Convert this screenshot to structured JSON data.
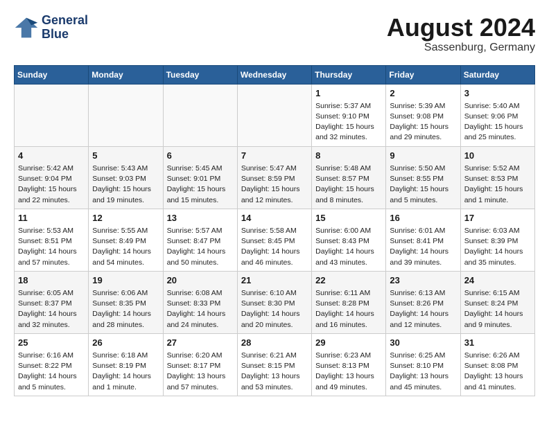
{
  "header": {
    "logo_line1": "General",
    "logo_line2": "Blue",
    "month_year": "August 2024",
    "location": "Sassenburg, Germany"
  },
  "weekdays": [
    "Sunday",
    "Monday",
    "Tuesday",
    "Wednesday",
    "Thursday",
    "Friday",
    "Saturday"
  ],
  "weeks": [
    [
      {
        "day": "",
        "info": ""
      },
      {
        "day": "",
        "info": ""
      },
      {
        "day": "",
        "info": ""
      },
      {
        "day": "",
        "info": ""
      },
      {
        "day": "1",
        "info": "Sunrise: 5:37 AM\nSunset: 9:10 PM\nDaylight: 15 hours\nand 32 minutes."
      },
      {
        "day": "2",
        "info": "Sunrise: 5:39 AM\nSunset: 9:08 PM\nDaylight: 15 hours\nand 29 minutes."
      },
      {
        "day": "3",
        "info": "Sunrise: 5:40 AM\nSunset: 9:06 PM\nDaylight: 15 hours\nand 25 minutes."
      }
    ],
    [
      {
        "day": "4",
        "info": "Sunrise: 5:42 AM\nSunset: 9:04 PM\nDaylight: 15 hours\nand 22 minutes."
      },
      {
        "day": "5",
        "info": "Sunrise: 5:43 AM\nSunset: 9:03 PM\nDaylight: 15 hours\nand 19 minutes."
      },
      {
        "day": "6",
        "info": "Sunrise: 5:45 AM\nSunset: 9:01 PM\nDaylight: 15 hours\nand 15 minutes."
      },
      {
        "day": "7",
        "info": "Sunrise: 5:47 AM\nSunset: 8:59 PM\nDaylight: 15 hours\nand 12 minutes."
      },
      {
        "day": "8",
        "info": "Sunrise: 5:48 AM\nSunset: 8:57 PM\nDaylight: 15 hours\nand 8 minutes."
      },
      {
        "day": "9",
        "info": "Sunrise: 5:50 AM\nSunset: 8:55 PM\nDaylight: 15 hours\nand 5 minutes."
      },
      {
        "day": "10",
        "info": "Sunrise: 5:52 AM\nSunset: 8:53 PM\nDaylight: 15 hours\nand 1 minute."
      }
    ],
    [
      {
        "day": "11",
        "info": "Sunrise: 5:53 AM\nSunset: 8:51 PM\nDaylight: 14 hours\nand 57 minutes."
      },
      {
        "day": "12",
        "info": "Sunrise: 5:55 AM\nSunset: 8:49 PM\nDaylight: 14 hours\nand 54 minutes."
      },
      {
        "day": "13",
        "info": "Sunrise: 5:57 AM\nSunset: 8:47 PM\nDaylight: 14 hours\nand 50 minutes."
      },
      {
        "day": "14",
        "info": "Sunrise: 5:58 AM\nSunset: 8:45 PM\nDaylight: 14 hours\nand 46 minutes."
      },
      {
        "day": "15",
        "info": "Sunrise: 6:00 AM\nSunset: 8:43 PM\nDaylight: 14 hours\nand 43 minutes."
      },
      {
        "day": "16",
        "info": "Sunrise: 6:01 AM\nSunset: 8:41 PM\nDaylight: 14 hours\nand 39 minutes."
      },
      {
        "day": "17",
        "info": "Sunrise: 6:03 AM\nSunset: 8:39 PM\nDaylight: 14 hours\nand 35 minutes."
      }
    ],
    [
      {
        "day": "18",
        "info": "Sunrise: 6:05 AM\nSunset: 8:37 PM\nDaylight: 14 hours\nand 32 minutes."
      },
      {
        "day": "19",
        "info": "Sunrise: 6:06 AM\nSunset: 8:35 PM\nDaylight: 14 hours\nand 28 minutes."
      },
      {
        "day": "20",
        "info": "Sunrise: 6:08 AM\nSunset: 8:33 PM\nDaylight: 14 hours\nand 24 minutes."
      },
      {
        "day": "21",
        "info": "Sunrise: 6:10 AM\nSunset: 8:30 PM\nDaylight: 14 hours\nand 20 minutes."
      },
      {
        "day": "22",
        "info": "Sunrise: 6:11 AM\nSunset: 8:28 PM\nDaylight: 14 hours\nand 16 minutes."
      },
      {
        "day": "23",
        "info": "Sunrise: 6:13 AM\nSunset: 8:26 PM\nDaylight: 14 hours\nand 12 minutes."
      },
      {
        "day": "24",
        "info": "Sunrise: 6:15 AM\nSunset: 8:24 PM\nDaylight: 14 hours\nand 9 minutes."
      }
    ],
    [
      {
        "day": "25",
        "info": "Sunrise: 6:16 AM\nSunset: 8:22 PM\nDaylight: 14 hours\nand 5 minutes."
      },
      {
        "day": "26",
        "info": "Sunrise: 6:18 AM\nSunset: 8:19 PM\nDaylight: 14 hours\nand 1 minute."
      },
      {
        "day": "27",
        "info": "Sunrise: 6:20 AM\nSunset: 8:17 PM\nDaylight: 13 hours\nand 57 minutes."
      },
      {
        "day": "28",
        "info": "Sunrise: 6:21 AM\nSunset: 8:15 PM\nDaylight: 13 hours\nand 53 minutes."
      },
      {
        "day": "29",
        "info": "Sunrise: 6:23 AM\nSunset: 8:13 PM\nDaylight: 13 hours\nand 49 minutes."
      },
      {
        "day": "30",
        "info": "Sunrise: 6:25 AM\nSunset: 8:10 PM\nDaylight: 13 hours\nand 45 minutes."
      },
      {
        "day": "31",
        "info": "Sunrise: 6:26 AM\nSunset: 8:08 PM\nDaylight: 13 hours\nand 41 minutes."
      }
    ]
  ]
}
